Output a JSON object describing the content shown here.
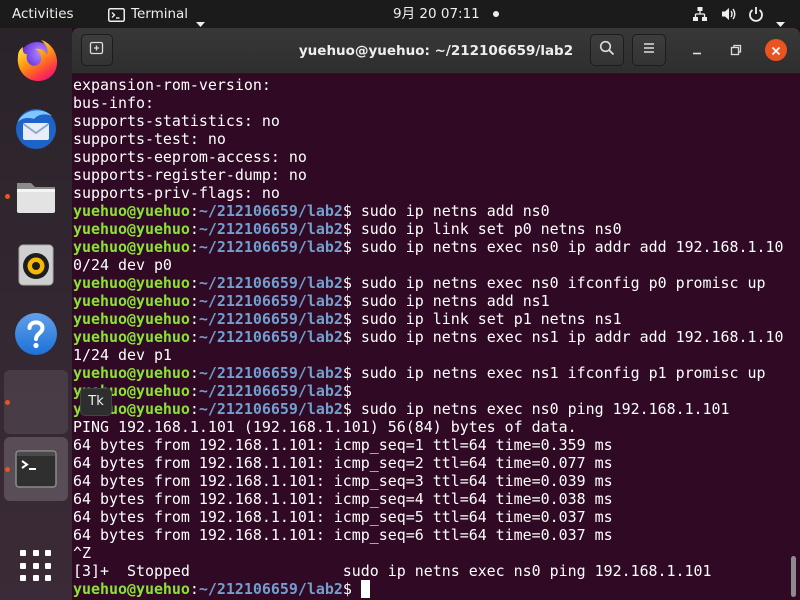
{
  "topbar": {
    "activities": "Activities",
    "app_menu": {
      "icon": "terminal-icon",
      "label": "Terminal"
    },
    "clock": "9月 20 07:11",
    "status_icons": [
      "network-wired-icon",
      "volume-icon",
      "power-icon"
    ]
  },
  "dock": {
    "items": [
      {
        "icon": "firefox-icon",
        "running": false
      },
      {
        "icon": "thunderbird-icon",
        "running": false
      },
      {
        "icon": "files-icon",
        "running": true
      },
      {
        "icon": "rhythmbox-icon",
        "running": false
      },
      {
        "icon": "help-icon",
        "running": false
      },
      {
        "icon": "tk-app-icon",
        "running": true,
        "hovered": true
      },
      {
        "icon": "terminal-icon",
        "running": true,
        "active": true
      },
      {
        "icon": "show-applications-icon",
        "running": false
      }
    ],
    "tooltip": "Tk"
  },
  "window": {
    "title": "yuehuo@yuehuo: ~/212106659/lab2",
    "buttons": [
      "new-tab-icon",
      "search-icon",
      "menu-icon",
      "minimize-icon",
      "maximize-icon",
      "close-icon"
    ]
  },
  "colors": {
    "accent": "#e95420",
    "terminal_bg": "#300a24",
    "terminal_fg": "#ffffff",
    "prompt_user": "#8ae234",
    "prompt_path": "#729fcf"
  },
  "terminal": {
    "prompt": {
      "user_host": "yuehuo@yuehuo",
      "sep": ":",
      "path": "~/212106659/lab2",
      "symbol": "$"
    },
    "lines": [
      {
        "text": "expansion-rom-version:"
      },
      {
        "text": "bus-info:"
      },
      {
        "text": "supports-statistics: no"
      },
      {
        "text": "supports-test: no"
      },
      {
        "text": "supports-eeprom-access: no"
      },
      {
        "text": "supports-register-dump: no"
      },
      {
        "text": "supports-priv-flags: no"
      },
      {
        "prompt": true,
        "cmd": "sudo ip netns add ns0"
      },
      {
        "prompt": true,
        "cmd": "sudo ip link set p0 netns ns0"
      },
      {
        "prompt": true,
        "cmd": "sudo ip netns exec ns0 ip addr add 192.168.1.10"
      },
      {
        "text": "0/24 dev p0"
      },
      {
        "prompt": true,
        "cmd": "sudo ip netns exec ns0 ifconfig p0 promisc up"
      },
      {
        "prompt": true,
        "cmd": "sudo ip netns add ns1"
      },
      {
        "prompt": true,
        "cmd": "sudo ip link set p1 netns ns1"
      },
      {
        "prompt": true,
        "cmd": "sudo ip netns exec ns1 ip addr add 192.168.1.10"
      },
      {
        "text": "1/24 dev p1"
      },
      {
        "prompt": true,
        "cmd": "sudo ip netns exec ns1 ifconfig p1 promisc up"
      },
      {
        "prompt": true
      },
      {
        "prompt": true,
        "cmd": "sudo ip netns exec ns0 ping 192.168.1.101"
      },
      {
        "text": "PING 192.168.1.101 (192.168.1.101) 56(84) bytes of data."
      },
      {
        "text": "64 bytes from 192.168.1.101: icmp_seq=1 ttl=64 time=0.359 ms"
      },
      {
        "text": "64 bytes from 192.168.1.101: icmp_seq=2 ttl=64 time=0.077 ms"
      },
      {
        "text": "64 bytes from 192.168.1.101: icmp_seq=3 ttl=64 time=0.039 ms"
      },
      {
        "text": "64 bytes from 192.168.1.101: icmp_seq=4 ttl=64 time=0.038 ms"
      },
      {
        "text": "64 bytes from 192.168.1.101: icmp_seq=5 ttl=64 time=0.037 ms"
      },
      {
        "text": "64 bytes from 192.168.1.101: icmp_seq=6 ttl=64 time=0.037 ms"
      },
      {
        "text": "^Z"
      },
      {
        "text": "[3]+  Stopped                 sudo ip netns exec ns0 ping 192.168.1.101"
      },
      {
        "prompt": true,
        "cursor": true
      }
    ]
  }
}
